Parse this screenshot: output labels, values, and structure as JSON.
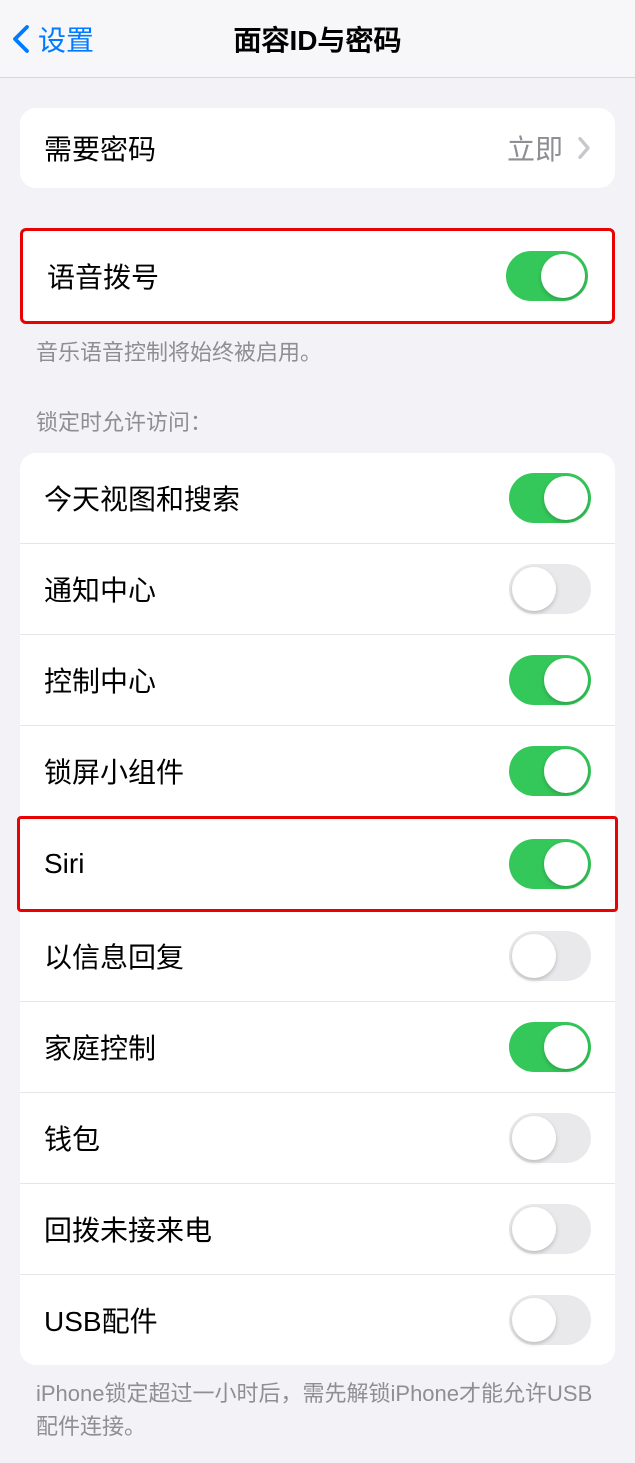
{
  "header": {
    "back_label": "设置",
    "title": "面容ID与密码"
  },
  "passcode_row": {
    "label": "需要密码",
    "value": "立即"
  },
  "voice_dial": {
    "label": "语音拨号",
    "on": true,
    "footer": "音乐语音控制将始终被启用。"
  },
  "locked_access": {
    "header": "锁定时允许访问：",
    "items": [
      {
        "label": "今天视图和搜索",
        "on": true
      },
      {
        "label": "通知中心",
        "on": false
      },
      {
        "label": "控制中心",
        "on": true
      },
      {
        "label": "锁屏小组件",
        "on": true
      },
      {
        "label": "Siri",
        "on": true
      },
      {
        "label": "以信息回复",
        "on": false
      },
      {
        "label": "家庭控制",
        "on": true
      },
      {
        "label": "钱包",
        "on": false
      },
      {
        "label": "回拨未接来电",
        "on": false
      },
      {
        "label": "USB配件",
        "on": false
      }
    ],
    "footer": "iPhone锁定超过一小时后，需先解锁iPhone才能允许USB配件连接。"
  }
}
